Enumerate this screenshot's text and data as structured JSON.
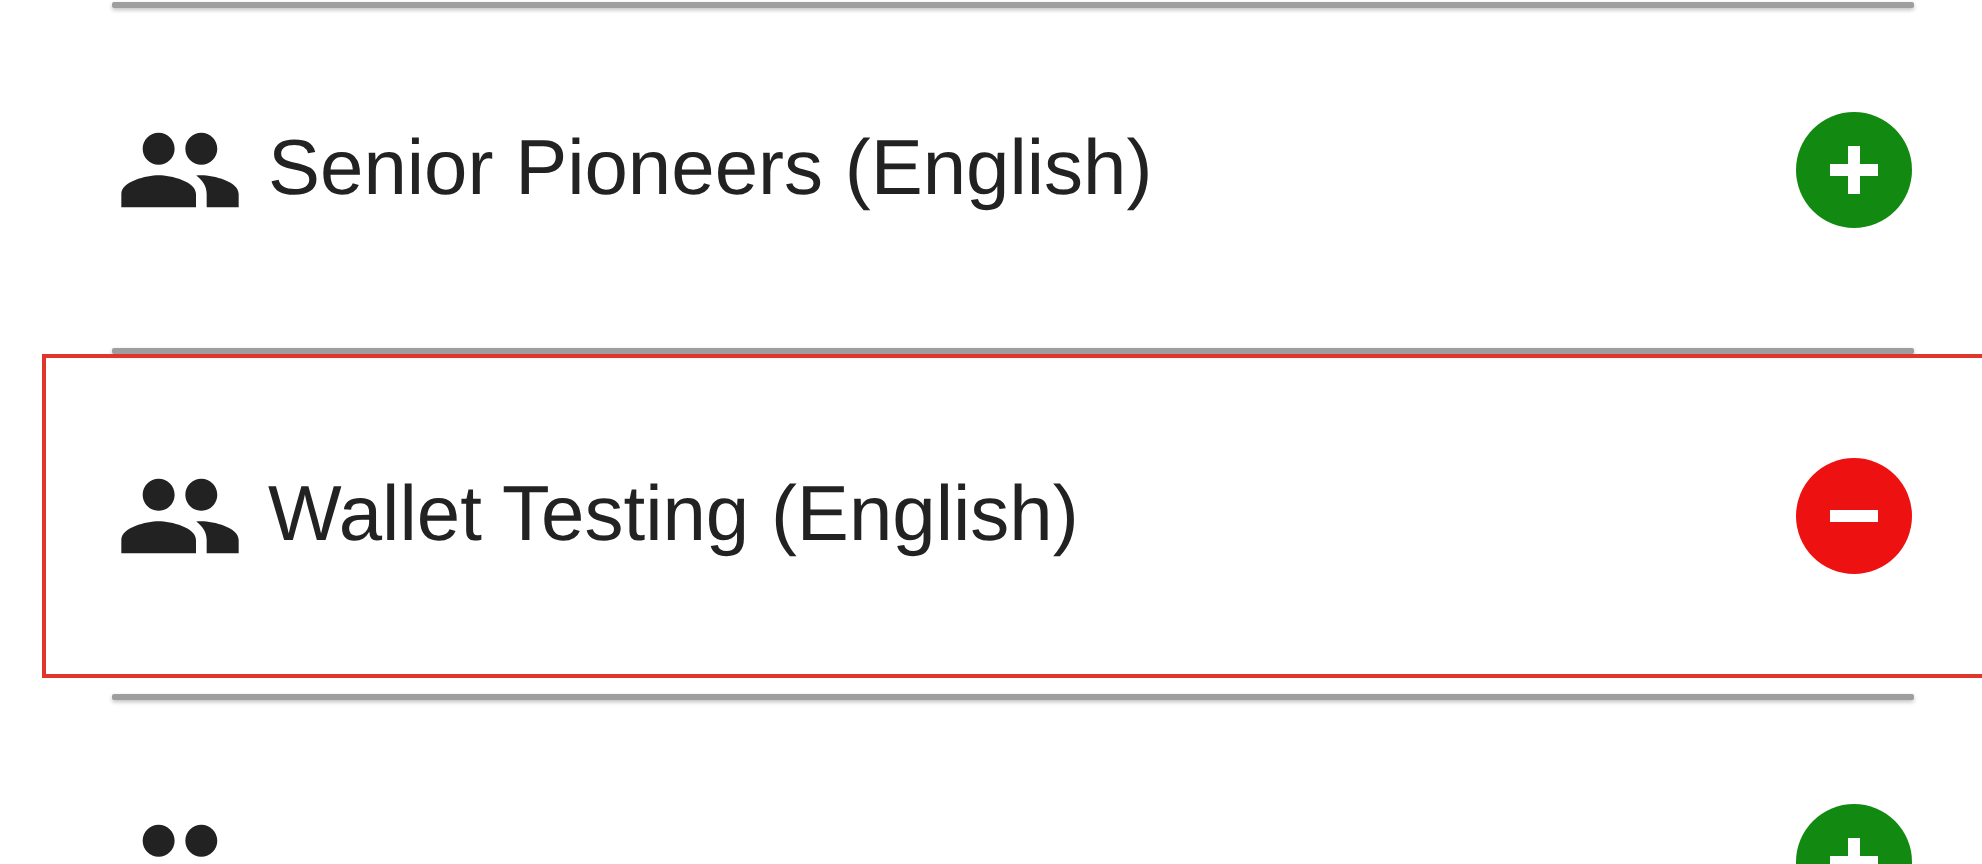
{
  "groups": [
    {
      "name": "Senior Pioneers (English)",
      "selected": false,
      "joined": false
    },
    {
      "name": "Wallet Testing (English)",
      "selected": true,
      "joined": true
    },
    {
      "selected": false,
      "joined": false
    }
  ]
}
